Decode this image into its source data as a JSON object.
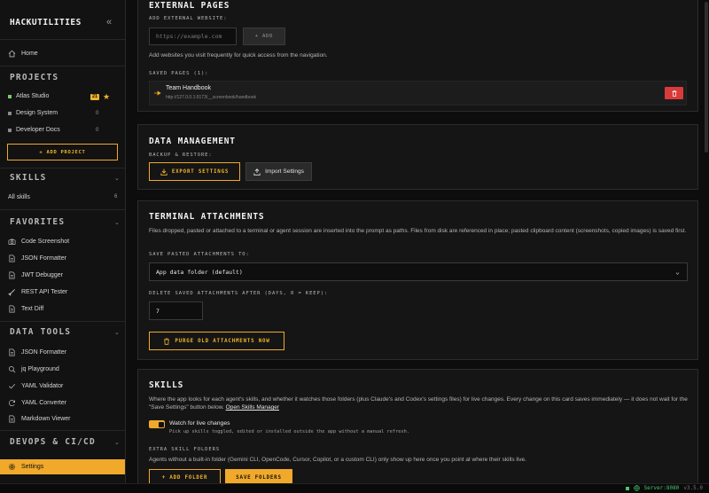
{
  "app": {
    "brand": "HACKUTILITIES",
    "collapse_icon": "double-chevron-left-icon"
  },
  "sidebar": {
    "home": "Home",
    "projects_title": "PROJECTS",
    "projects": [
      {
        "name": "Atlas Studio",
        "count": "",
        "badge": "21",
        "starred": true,
        "color": "#7bc86c"
      },
      {
        "name": "Design System",
        "count": "0",
        "color": "#8a8a8a"
      },
      {
        "name": "Developer Docs",
        "count": "0",
        "color": "#8a8a8a"
      }
    ],
    "add_project": "+ ADD PROJECT",
    "skills_title": "SKILLS",
    "all_skills": "All skills",
    "all_skills_count": "6",
    "favorites_title": "FAVORITES",
    "favorites": [
      "Code Screenshot",
      "JSON Formatter",
      "JWT Debugger",
      "REST API Tester",
      "Text Diff"
    ],
    "data_tools_title": "DATA TOOLS",
    "data_tools": [
      "JSON Formatter",
      "jq Playground",
      "YAML Validator",
      "YAML Converter",
      "Markdown Viewer"
    ],
    "devops_title": "DEVOPS & CI/CD",
    "settings": "Settings"
  },
  "external": {
    "title": "EXTERNAL PAGES",
    "add_label": "ADD EXTERNAL WEBSITE:",
    "url_placeholder": "https://example.com",
    "add_button": "+ ADD",
    "hint": "Add websites you visit frequently for quick access from the navigation.",
    "saved_label": "SAVED PAGES (1):",
    "saved": [
      {
        "name": "Team Handbook",
        "url": "http://127.0.0.1:5173/__screenbook/handbook"
      }
    ]
  },
  "data_mgmt": {
    "title": "DATA MANAGEMENT",
    "backup_label": "BACKUP & RESTORE:",
    "export": "EXPORT SETTINGS",
    "import": "Import Settings"
  },
  "terminal": {
    "title": "TERMINAL ATTACHMENTS",
    "desc1": "Files dropped, pasted or attached to a terminal or agent session are inserted into the prompt as paths. Files from disk are referenced in place; pasted clipboard content (screenshots, copied images) is",
    "desc2": "saved first.",
    "save_label": "SAVE PASTED ATTACHMENTS TO:",
    "save_value": "App data folder (default)",
    "delete_label": "DELETE SAVED ATTACHMENTS AFTER (DAYS, 0 = KEEP):",
    "delete_value": "7",
    "purge": "PURGE OLD ATTACHMENTS NOW"
  },
  "skills": {
    "title": "SKILLS",
    "desc1": "Where the app looks for each agent's skills, and whether it watches those folders (plus Claude's and Codex's settings files) for live changes. Every change on this card saves immediately — it does not",
    "desc2": "wait for the \"Save Settings\" button below.",
    "manager_link": "Open Skills Manager",
    "watch_label": "Watch for live changes",
    "watch_sub": "Pick up skills toggled, edited or installed outside the app without a manual refresh.",
    "extra_label": "EXTRA SKILL FOLDERS",
    "extra_desc": "Agents without a built-in folder (Gemini CLI, OpenCode, Cursor, Copilot, or a custom CLI) only show up here once you point at where their skills live.",
    "add_folder": "+ ADD FOLDER",
    "save_folders": "SAVE FOLDERS"
  },
  "status": {
    "server": "Server:8080",
    "version": "v3.5.0"
  }
}
